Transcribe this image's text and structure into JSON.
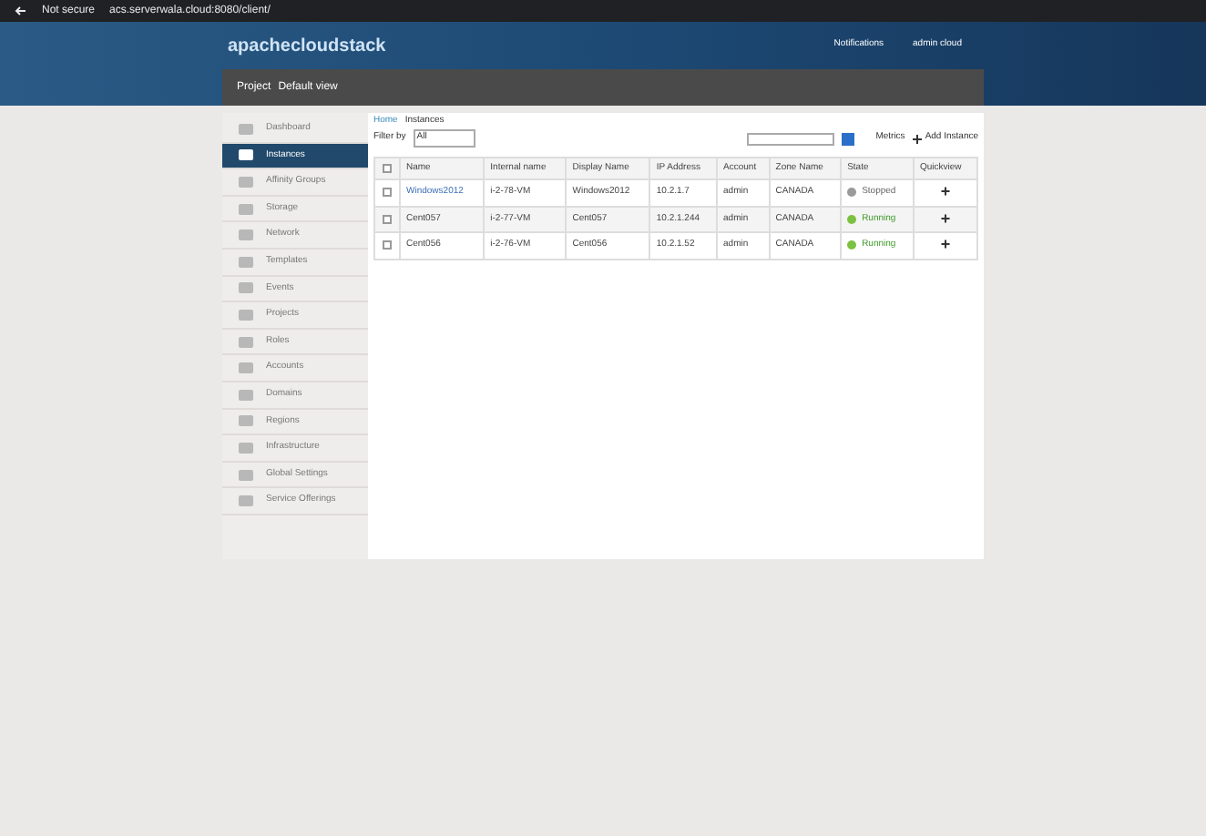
{
  "browser": {
    "security": "Not secure",
    "url": "acs.serverwala.cloud:8080/client/"
  },
  "header": {
    "logo": "apachecloudstack",
    "notifications": "Notifications",
    "user": "admin cloud"
  },
  "project_bar": {
    "label": "Project",
    "value": "Default view"
  },
  "sidebar": {
    "items": [
      {
        "label": "Dashboard",
        "selected": false
      },
      {
        "label": "Instances",
        "selected": true
      },
      {
        "label": "Affinity Groups",
        "selected": false
      },
      {
        "label": "Storage",
        "selected": false
      },
      {
        "label": "Network",
        "selected": false
      },
      {
        "label": "Templates",
        "selected": false
      },
      {
        "label": "Events",
        "selected": false
      },
      {
        "label": "Projects",
        "selected": false
      },
      {
        "label": "Roles",
        "selected": false
      },
      {
        "label": "Accounts",
        "selected": false
      },
      {
        "label": "Domains",
        "selected": false
      },
      {
        "label": "Regions",
        "selected": false
      },
      {
        "label": "Infrastructure",
        "selected": false
      },
      {
        "label": "Global Settings",
        "selected": false
      },
      {
        "label": "Service Offerings",
        "selected": false
      }
    ]
  },
  "breadcrumb": [
    "Home",
    "Instances"
  ],
  "toolbar": {
    "filter_label": "Filter by",
    "filter_value": "All",
    "metrics": "Metrics",
    "add": "Add Instance"
  },
  "table": {
    "select_all_checked": false,
    "columns": [
      "Name",
      "Internal name",
      "Display Name",
      "IP Address",
      "Account",
      "Zone Name",
      "State",
      "Quickview"
    ],
    "rows": [
      {
        "name": "Windows2012",
        "internal": "i-2-78-VM",
        "display": "Windows2012",
        "ip": "10.2.1.7",
        "account": "admin",
        "zone": "CANADA",
        "state": "Stopped",
        "checked": false,
        "color": "#9a9a9a",
        "action": "+"
      },
      {
        "name": "Cent057",
        "internal": "i-2-77-VM",
        "display": "Cent057",
        "ip": "10.2.1.244",
        "account": "admin",
        "zone": "CANADA",
        "state": "Running",
        "checked": false,
        "color": "#7cc242",
        "action": "+"
      },
      {
        "name": "Cent056",
        "internal": "i-2-76-VM",
        "display": "Cent056",
        "ip": "10.2.1.52",
        "account": "admin",
        "zone": "CANADA",
        "state": "Running",
        "checked": false,
        "color": "#7cc242",
        "action": "+"
      }
    ]
  }
}
